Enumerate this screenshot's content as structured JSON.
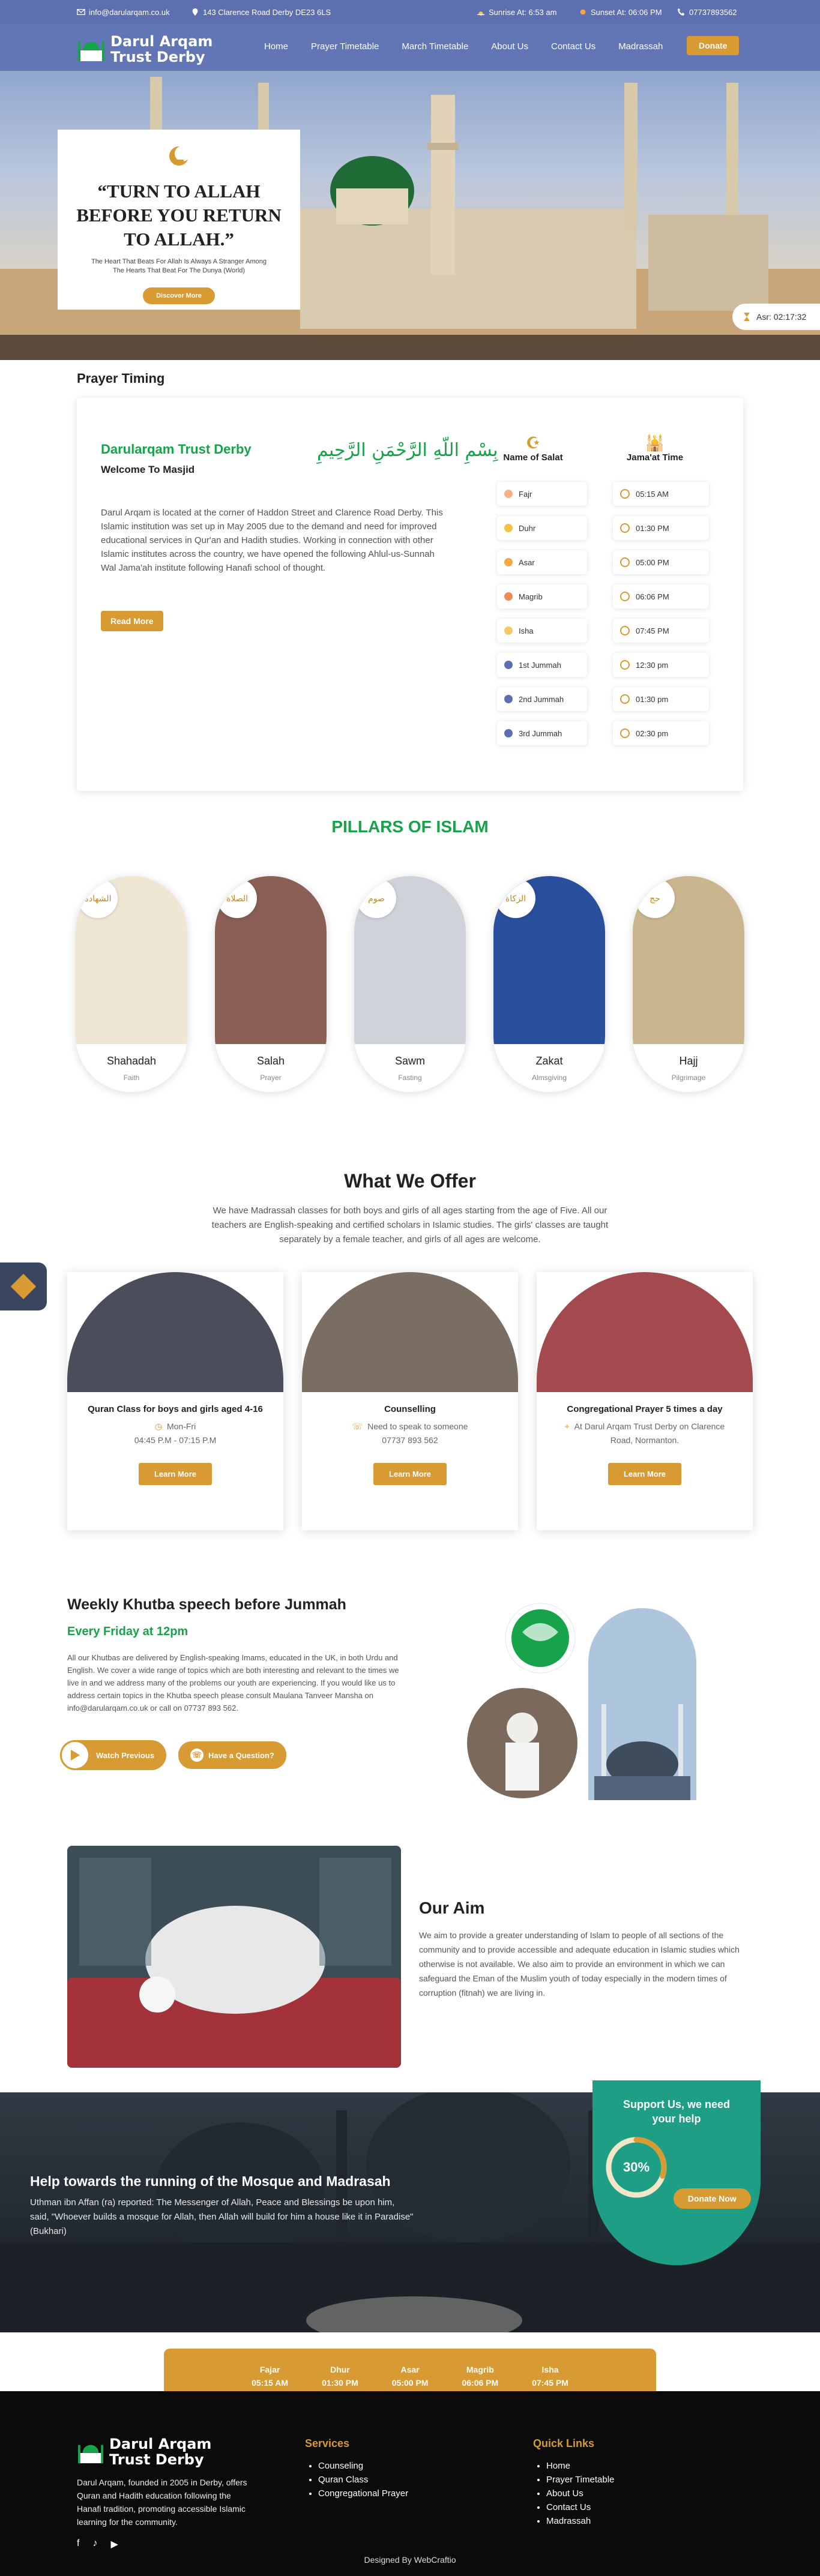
{
  "topbar": {
    "email": "info@darularqam.co.uk",
    "address": "143 Clarence Road Derby DE23 6LS",
    "sunrise": "Sunrise At: 6:53 am",
    "sunset": "Sunset At: 06:06 PM",
    "phone": "07737893562"
  },
  "brand": {
    "line1": "Darul Arqam",
    "line2": "Trust Derby"
  },
  "nav": {
    "items": [
      "Home",
      "Prayer Timetable",
      "March Timetable",
      "About Us",
      "Contact Us",
      "Madrassah"
    ],
    "donate": "Donate"
  },
  "hero": {
    "quote": "“TURN TO ALLAH BEFORE YOU RETURN TO ALLAH.”",
    "sub": "The Heart That Beats For Allah Is Always A Stranger Among The Hearts That Beat For The Dunya (World)",
    "button": "Discover More",
    "asr": "Asr: 02:17:32"
  },
  "prayer": {
    "section_title": "Prayer Timing",
    "title": "Darularqam Trust Derby",
    "welcome": "Welcome To Masjid",
    "calligraphy": "بِسْمِ اللّهِ الرَّحْمَنِ الرَّحِيمِ",
    "text": "Darul Arqam is located at the corner of Haddon Street and Clarence Road Derby. This Islamic institution was set up in May 2005 due to the demand and need for improved educational services in Qur'an and Hadith studies. Working in connection with other Islamic institutes across the country, we have opened the following Ahlul-us-Sunnah Wal Jama'ah institute following Hanafi school of thought.",
    "button": "Read More",
    "col1": "Name of Salat",
    "col2": "Jama'at Time",
    "rows": [
      {
        "name": "Fajr",
        "time": "05:15 AM"
      },
      {
        "name": "Duhr",
        "time": "01:30 PM"
      },
      {
        "name": "Asar",
        "time": "05:00 PM"
      },
      {
        "name": "Magrib",
        "time": "06:06 PM"
      },
      {
        "name": "Isha",
        "time": "07:45 PM"
      },
      {
        "name": "1st Jummah",
        "time": "12:30 pm"
      },
      {
        "name": "2nd Jummah",
        "time": "01:30 pm"
      },
      {
        "name": "3rd Jummah",
        "time": "02:30 pm"
      }
    ]
  },
  "pillars": {
    "title": "PILLARS OF ISLAM",
    "items": [
      {
        "arabic": "الشهادة",
        "name": "Shahadah",
        "sub": "Faith"
      },
      {
        "arabic": "الصلاة",
        "name": "Salah",
        "sub": "Prayer"
      },
      {
        "arabic": "صوم",
        "name": "Sawm",
        "sub": "Fasting"
      },
      {
        "arabic": "الزكاة",
        "name": "Zakat",
        "sub": "Almsgiving"
      },
      {
        "arabic": "حج",
        "name": "Hajj",
        "sub": "Pilgrimage"
      }
    ]
  },
  "offer": {
    "title": "What We Offer",
    "text": "We have Madrassah classes for both boys and girls of all ages starting from the age of Five. All our teachers are English-speaking and certified scholars in Islamic studies. The girls' classes are taught separately by a female teacher, and girls of all ages are welcome.",
    "cards": [
      {
        "title": "Quran Class for boys and girls aged 4-16",
        "line1": "Mon-Fri",
        "line2": "04:45 P.M - 07:15 P.M",
        "button": "Learn More"
      },
      {
        "title": "Counselling",
        "line1": "Need to speak to someone",
        "line2": "07737 893 562",
        "button": "Learn More"
      },
      {
        "title": "Congregational Prayer 5 times a day",
        "line1": "At Darul Arqam Trust Derby on Clarence",
        "line2": "Road, Normanton.",
        "button": "Learn More"
      }
    ]
  },
  "khutba": {
    "title": "Weekly Khutba speech before Jummah",
    "sub": "Every Friday at 12pm",
    "text": "All our Khutbas are delivered by English-speaking Imams, educated in the UK, in both Urdu and English. We cover a wide range of topics which are both interesting and relevant to the times we live in and we address many of the problems our youth are experiencing. If you would like us to address certain topics in the Khutba speech please consult Maulana Tanveer Mansha on info@darularqam.co.uk or call on 07737 893 562.",
    "watch": "Watch Previous",
    "question": "Have a Question?"
  },
  "aim": {
    "title": "Our Aim",
    "text": "We aim to provide a greater understanding of Islam to people of all sections of the community and to provide accessible and adequate education in Islamic studies which otherwise is not available. We also aim to provide an environment in which we can safeguard the Eman of the Muslim youth of today especially in the modern times of corruption (fitnah) we are living in."
  },
  "help": {
    "title": "Help towards the running of the Mosque and Madrasah",
    "text": "Uthman ibn Affan (ra) reported: The Messenger of Allah, Peace and Blessings be upon him, said, \"Whoever builds a mosque for Allah, then Allah will build for him a house like it in Paradise\" (Bukhari)",
    "support_title": "Support Us, we need your help",
    "progress_label": "30%",
    "progress": 0.3,
    "donate": "Donate Now"
  },
  "times": [
    {
      "name": "Fajar",
      "time": "05:15 AM"
    },
    {
      "name": "Dhur",
      "time": "01:30 PM"
    },
    {
      "name": "Asar",
      "time": "05:00 PM"
    },
    {
      "name": "Magrib",
      "time": "06:06 PM"
    },
    {
      "name": "Isha",
      "time": "07:45 PM"
    }
  ],
  "footer": {
    "about": "Darul Arqam, founded in 2005 in Derby, offers Quran and Hadith education following the Hanafi tradition, promoting accessible Islamic learning for the community.",
    "services_title": "Services",
    "services": [
      "Counseling",
      "Quran Class",
      "Congregational Prayer"
    ],
    "links_title": "Quick Links",
    "links": [
      "Home",
      "Prayer Timetable",
      "About Us",
      "Contact Us",
      "Madrassah"
    ],
    "credit": "Designed By WebCraftio"
  },
  "colors": {
    "accent": "#d89a32",
    "green": "#16a34a",
    "nav": "#6276b6",
    "teal": "#1e9e84"
  }
}
